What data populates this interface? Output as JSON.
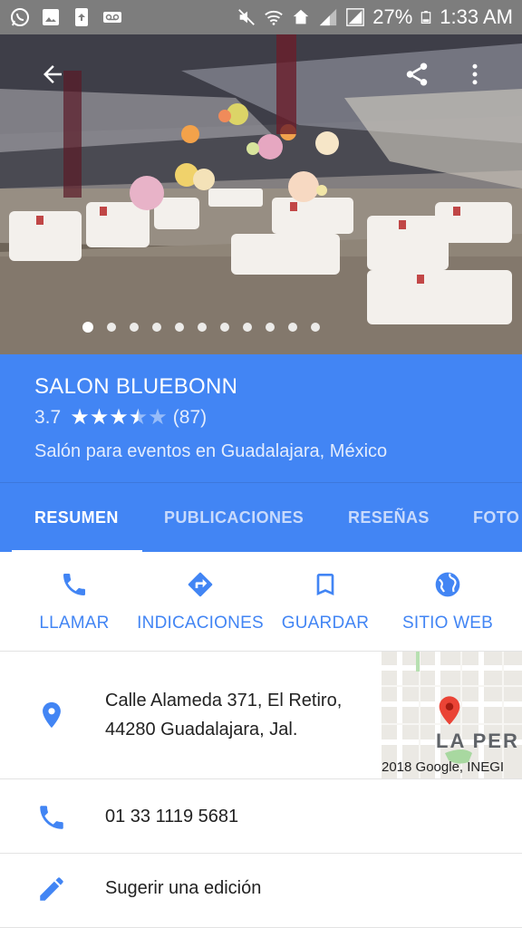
{
  "status_bar": {
    "battery_percent": "27%",
    "time": "1:33 AM"
  },
  "hero": {
    "photo_count": 11,
    "active_photo_index": 0
  },
  "place": {
    "name": "SALON BLUEBONN",
    "rating": "3.7",
    "rating_value": 3.7,
    "review_count": "(87)",
    "category": "Salón para eventos en Guadalajara, México"
  },
  "tabs": [
    {
      "label": "RESUMEN",
      "active": true
    },
    {
      "label": "PUBLICACIONES",
      "active": false
    },
    {
      "label": "RESEÑAS",
      "active": false
    },
    {
      "label": "FOTO",
      "active": false
    }
  ],
  "actions": {
    "call": "LLAMAR",
    "directions": "INDICACIONES",
    "save": "GUARDAR",
    "website": "SITIO WEB"
  },
  "address": {
    "line1": "Calle Alameda 371, El Retiro,",
    "line2": "44280 Guadalajara, Jal."
  },
  "map": {
    "label": "LA PER",
    "copyright": "2018 Google, INEGI"
  },
  "phone": "01 33 1119 5681",
  "suggest_edit": "Sugerir una edición",
  "colors": {
    "brand_blue": "#4285f4",
    "status_bar": "#7d7d7d",
    "map_pin": "#ea4335"
  }
}
